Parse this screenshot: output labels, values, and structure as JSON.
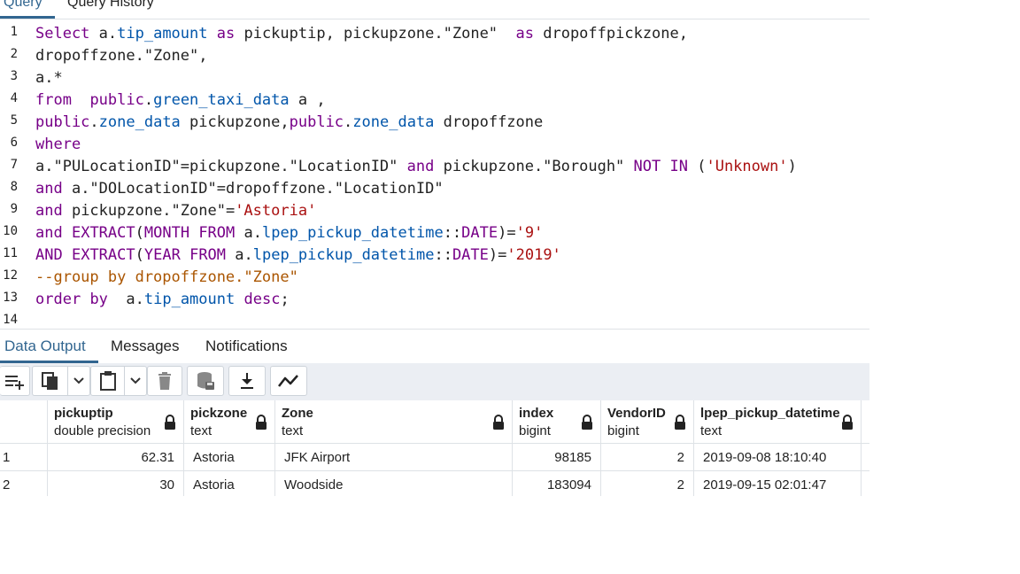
{
  "top_tabs": [
    {
      "label": "Query",
      "active": true
    },
    {
      "label": "Query History",
      "active": false
    }
  ],
  "editor": {
    "line_numbers": [
      "1",
      "2",
      "3",
      "4",
      "5",
      "6",
      "7",
      "8",
      "9",
      "10",
      "11",
      "12",
      "13",
      "14"
    ],
    "lines": [
      "Select a.tip_amount as pickuptip, pickupzone.\"Zone\"  as dropoffpickzone,",
      "dropoffzone.\"Zone\",",
      "a.*",
      "from  public.green_taxi_data a ,",
      "public.zone_data pickupzone,public.zone_data dropoffzone",
      "where",
      "a.\"PULocationID\"=pickupzone.\"LocationID\" and pickupzone.\"Borough\" NOT IN ('Unknown')",
      "and a.\"DOLocationID\"=dropoffzone.\"LocationID\"",
      "and pickupzone.\"Zone\"='Astoria'",
      "and EXTRACT(MONTH FROM a.lpep_pickup_datetime::DATE)='9'",
      "AND EXTRACT(YEAR FROM a.lpep_pickup_datetime::DATE)='2019'",
      "--group by dropoffzone.\"Zone\"",
      "order by  a.tip_amount desc;",
      ""
    ]
  },
  "bottom_tabs": [
    {
      "label": "Data Output",
      "active": true
    },
    {
      "label": "Messages",
      "active": false
    },
    {
      "label": "Notifications",
      "active": false
    }
  ],
  "toolbar": {
    "icons": [
      "add-row-icon",
      "copy-icon",
      "chevron-down-icon",
      "paste-icon",
      "chevron-down-icon",
      "delete-icon",
      "save-data-icon",
      "download-icon",
      "graph-icon"
    ]
  },
  "grid": {
    "columns": [
      {
        "name": "pickuptip",
        "type": "double precision"
      },
      {
        "name": "pickzone",
        "type": "text"
      },
      {
        "name": "Zone",
        "type": "text"
      },
      {
        "name": "index",
        "type": "bigint"
      },
      {
        "name": "VendorID",
        "type": "bigint"
      },
      {
        "name": "lpep_pickup_datetime",
        "type": "text"
      }
    ],
    "rows": [
      {
        "n": "1",
        "cells": [
          "62.31",
          "Astoria",
          "JFK Airport",
          "98185",
          "2",
          "2019-09-08 18:10:40"
        ]
      },
      {
        "n": "2",
        "cells": [
          "30",
          "Astoria",
          "Woodside",
          "183094",
          "2",
          "2019-09-15 02:01:47"
        ]
      }
    ]
  },
  "colors": {
    "accent": "#326690",
    "keyword": "#770088",
    "builtin": "#0055aa",
    "string": "#aa1111",
    "comment": "#aa5500"
  }
}
